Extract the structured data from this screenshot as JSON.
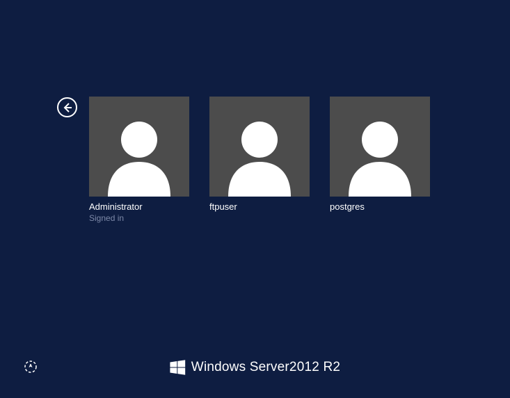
{
  "users": [
    {
      "name": "Administrator",
      "status": "Signed in"
    },
    {
      "name": "ftpuser",
      "status": ""
    },
    {
      "name": "postgres",
      "status": ""
    }
  ],
  "branding": {
    "product": "Windows Server",
    "version": "2012",
    "release": "R2"
  }
}
